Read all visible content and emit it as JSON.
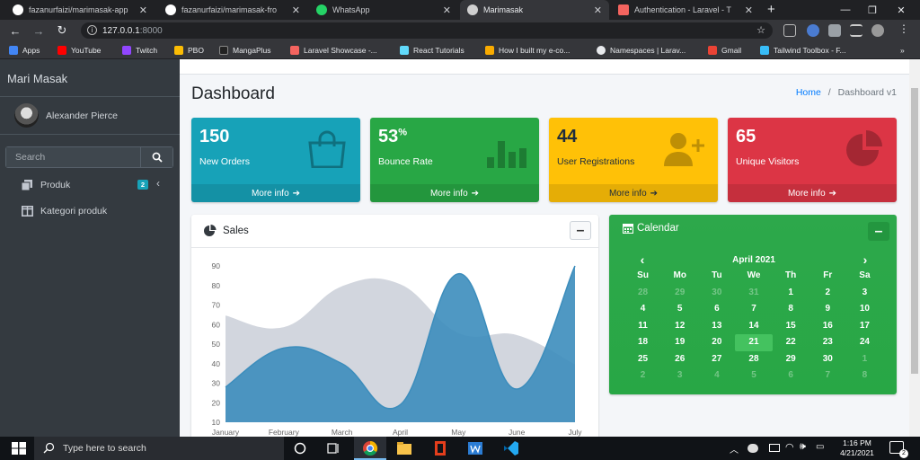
{
  "browser": {
    "tabs": [
      {
        "title": "fazanurfaizi/marimasak-app",
        "icon": "github-icon",
        "active": false
      },
      {
        "title": "fazanurfaizi/marimasak-fro",
        "icon": "github-icon",
        "active": false
      },
      {
        "title": "WhatsApp",
        "icon": "whatsapp-icon",
        "active": false
      },
      {
        "title": "Marimasak",
        "icon": "globe-icon",
        "active": true
      },
      {
        "title": "Authentication - Laravel - T",
        "icon": "laravel-icon",
        "active": false
      }
    ],
    "url_host": "127.0.0.1",
    "url_port": ":8000",
    "bookmarks": [
      "Apps",
      "YouTube",
      "Twitch",
      "PBO",
      "MangaPlus",
      "Laravel Showcase -...",
      "React Tutorials",
      "How I built my e-co...",
      "Namespaces | Larav...",
      "Gmail",
      "Tailwind Toolbox - F..."
    ],
    "bookmarks_more": "»"
  },
  "sidebar": {
    "brand": "Mari Masak",
    "user": "Alexander Pierce",
    "search_placeholder": "Search",
    "items": [
      {
        "label": "Produk",
        "badge": "2",
        "icon": "copy-icon"
      },
      {
        "label": "Kategori produk",
        "icon": "columns-icon"
      }
    ]
  },
  "header": {
    "title": "Dashboard",
    "breadcrumb_home": "Home",
    "breadcrumb_sep": "/",
    "breadcrumb_current": "Dashboard v1"
  },
  "stats": [
    {
      "value": "150",
      "suffix": "",
      "label": "New Orders",
      "more": "More info",
      "color": "#17a2b8",
      "icon": "shopping-bag-icon"
    },
    {
      "value": "53",
      "suffix": "%",
      "label": "Bounce Rate",
      "more": "More info",
      "color": "#28a745",
      "icon": "bar-chart-icon"
    },
    {
      "value": "44",
      "suffix": "",
      "label": "User Registrations",
      "more": "More info",
      "color": "#ffc107",
      "icon": "user-plus-icon"
    },
    {
      "value": "65",
      "suffix": "",
      "label": "Unique Visitors",
      "more": "More info",
      "color": "#dc3545",
      "icon": "pie-chart-icon"
    }
  ],
  "sales": {
    "title": "Sales",
    "collapse": "–"
  },
  "chart_data": {
    "type": "area",
    "title": "Sales",
    "categories": [
      "January",
      "February",
      "March",
      "April",
      "May",
      "June",
      "July"
    ],
    "ylim": [
      10,
      90
    ],
    "yticks": [
      10,
      20,
      30,
      40,
      50,
      60,
      70,
      80,
      90
    ],
    "grid": false,
    "series": [
      {
        "values": [
          65,
          59,
          80,
          81,
          56,
          55,
          40
        ],
        "color": "#d2d6de"
      },
      {
        "values": [
          28,
          48,
          40,
          19,
          86,
          27,
          90
        ],
        "color": "#3c8dbc"
      }
    ]
  },
  "calendar": {
    "title": "Calendar",
    "collapse": "–",
    "month": "April 2021",
    "prev": "‹",
    "next": "›",
    "days": [
      "Su",
      "Mo",
      "Tu",
      "We",
      "Th",
      "Fr",
      "Sa"
    ],
    "weeks": [
      [
        "28",
        "29",
        "30",
        "31",
        "1",
        "2",
        "3"
      ],
      [
        "4",
        "5",
        "6",
        "7",
        "8",
        "9",
        "10"
      ],
      [
        "11",
        "12",
        "13",
        "14",
        "15",
        "16",
        "17"
      ],
      [
        "18",
        "19",
        "20",
        "21",
        "22",
        "23",
        "24"
      ],
      [
        "25",
        "26",
        "27",
        "28",
        "29",
        "30",
        "1"
      ],
      [
        "2",
        "3",
        "4",
        "5",
        "6",
        "7",
        "8"
      ]
    ],
    "today": "21"
  },
  "taskbar": {
    "search_placeholder": "Type here to search",
    "time": "1:16 PM",
    "date": "4/21/2021",
    "notifications": "2"
  }
}
